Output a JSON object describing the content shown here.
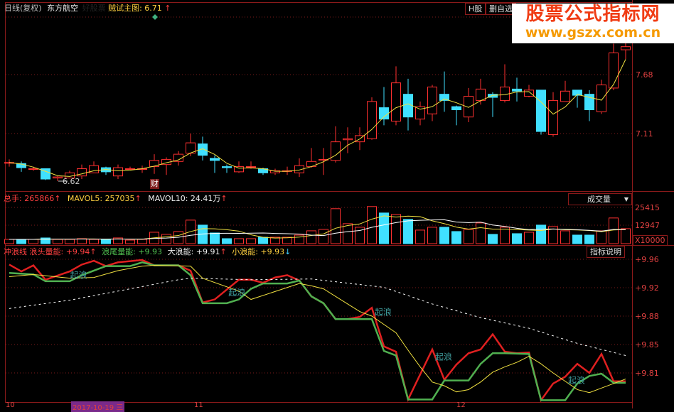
{
  "header": {
    "period": "日线(复权)",
    "stock_name": "东方航空",
    "hidden_label": "好股票",
    "indicator_name": "贼试主图",
    "indicator_value": "6.71",
    "arrow": "↑",
    "tab_h": "H股",
    "tab_watch": "删自选"
  },
  "logo": {
    "line1": "股票公式指标网",
    "line2": "www.gszx.com.cn"
  },
  "main": {
    "price_ticks": [
      "7.68",
      "7.11"
    ],
    "low_label": "6.62",
    "finance_badge": "财",
    "colors": {
      "up": "#ff3030",
      "down": "#40e0ff",
      "ma": "#f0e040"
    }
  },
  "volume": {
    "label_total": "总手",
    "total": "265866",
    "label_mavol5": "MAVOL5",
    "mavol5": "257035",
    "label_mavol10": "MAVOL10",
    "mavol10": "24.41万",
    "dropdown": "成交量",
    "ticks": [
      "25415",
      "12947"
    ],
    "unit": "X10000"
  },
  "indicator": {
    "name": "冲浪线",
    "l1_label": "浪头量能",
    "l1": "+9.94",
    "l2_label": "浪尾量能",
    "l2": "+9.93",
    "l3_label": "大浪能",
    "l3": "+9.91",
    "l4_label": "小浪能",
    "l4": "+9.93",
    "help_button": "指标说明",
    "ticks": [
      "+9.96",
      "+9.92",
      "+9.88",
      "+9.85",
      "+9.81"
    ],
    "wave_label": "起浪"
  },
  "time_axis": {
    "labels": [
      "10",
      "11",
      "12"
    ],
    "cursor_date": "2017-10-19 三"
  },
  "chart_data": {
    "type": "candlestick",
    "candles": [
      [
        6.83,
        6.83,
        6.86,
        6.79
      ],
      [
        6.82,
        6.78,
        6.84,
        6.74
      ],
      [
        6.77,
        6.77,
        6.79,
        6.75
      ],
      [
        6.77,
        6.67,
        6.77,
        6.66
      ],
      [
        6.68,
        6.69,
        6.7,
        6.65
      ],
      [
        6.68,
        6.73,
        6.75,
        6.68
      ],
      [
        6.7,
        6.77,
        6.81,
        6.67
      ],
      [
        6.73,
        6.8,
        6.84,
        6.73
      ],
      [
        6.78,
        6.74,
        6.79,
        6.71
      ],
      [
        6.7,
        6.78,
        6.81,
        6.67
      ],
      [
        6.77,
        6.77,
        6.79,
        6.76
      ],
      [
        6.77,
        6.77,
        6.8,
        6.73
      ],
      [
        6.79,
        6.85,
        6.91,
        6.72
      ],
      [
        6.81,
        6.86,
        6.88,
        6.71
      ],
      [
        6.84,
        6.91,
        6.94,
        6.8
      ],
      [
        6.92,
        7.02,
        7.11,
        6.89
      ],
      [
        7.01,
        6.9,
        7.08,
        6.85
      ],
      [
        6.87,
        6.85,
        6.9,
        6.73
      ],
      [
        6.79,
        6.78,
        6.81,
        6.73
      ],
      [
        6.74,
        6.79,
        6.84,
        6.73
      ],
      [
        6.79,
        6.79,
        6.84,
        6.77
      ],
      [
        6.77,
        6.73,
        6.78,
        6.71
      ],
      [
        6.73,
        6.75,
        6.77,
        6.71
      ],
      [
        6.75,
        6.75,
        6.79,
        6.71
      ],
      [
        6.73,
        6.8,
        6.87,
        6.69
      ],
      [
        6.79,
        6.84,
        6.97,
        6.78
      ],
      [
        6.86,
        6.86,
        6.97,
        6.71
      ],
      [
        6.85,
        7.03,
        7.18,
        6.83
      ],
      [
        7.05,
        7.06,
        7.17,
        6.92
      ],
      [
        7.03,
        7.09,
        7.17,
        6.95
      ],
      [
        7.06,
        7.42,
        7.46,
        7.05
      ],
      [
        7.36,
        7.25,
        7.56,
        7.19
      ],
      [
        7.23,
        7.6,
        7.76,
        7.19
      ],
      [
        7.49,
        7.27,
        7.64,
        7.14
      ],
      [
        7.25,
        7.37,
        7.42,
        7.19
      ],
      [
        7.3,
        7.56,
        7.58,
        7.23
      ],
      [
        7.49,
        7.43,
        7.71,
        7.32
      ],
      [
        7.37,
        7.34,
        7.38,
        7.19
      ],
      [
        7.27,
        7.47,
        7.55,
        7.22
      ],
      [
        7.43,
        7.54,
        7.64,
        7.39
      ],
      [
        7.49,
        7.46,
        7.51,
        7.27
      ],
      [
        7.43,
        7.56,
        7.78,
        7.41
      ],
      [
        7.54,
        7.52,
        7.65,
        7.42
      ],
      [
        7.47,
        7.53,
        7.58,
        7.46
      ],
      [
        7.53,
        7.13,
        7.53,
        7.1
      ],
      [
        7.1,
        7.43,
        7.51,
        7.08
      ],
      [
        7.42,
        7.52,
        7.62,
        7.42
      ],
      [
        7.53,
        7.48,
        7.53,
        7.36
      ],
      [
        7.49,
        7.34,
        7.53,
        7.23
      ],
      [
        7.32,
        7.58,
        7.63,
        7.3
      ],
      [
        7.55,
        7.89,
        7.98,
        7.53
      ],
      [
        7.92,
        7.95,
        7.99,
        7.83
      ]
    ],
    "volumes": [
      3000,
      3000,
      3000,
      4000,
      3000,
      3000,
      3500,
      3000,
      3000,
      4000,
      2500,
      3000,
      8000,
      6500,
      8500,
      16500,
      13000,
      7500,
      3500,
      3500,
      3500,
      4500,
      4500,
      4500,
      6000,
      9000,
      10000,
      24500,
      14000,
      11500,
      26000,
      21500,
      20500,
      17000,
      9500,
      11500,
      11500,
      8500,
      10000,
      14500,
      6500,
      11500,
      7000,
      8000,
      13000,
      12000,
      9000,
      6000,
      6000,
      9000,
      18000,
      10500
    ],
    "indicator_series": [
      {
        "name": "浪头量能",
        "color": "#e02020",
        "points": [
          [
            0,
            9.953
          ],
          [
            1,
            9.944
          ],
          [
            2,
            9.952
          ],
          [
            3,
            9.933
          ],
          [
            5,
            9.944
          ],
          [
            6,
            9.953
          ],
          [
            7,
            9.958
          ],
          [
            8,
            9.951
          ],
          [
            9,
            9.956
          ],
          [
            11,
            9.959
          ],
          [
            12,
            9.952
          ],
          [
            14,
            9.952
          ],
          [
            15,
            9.945
          ],
          [
            16,
            9.903
          ],
          [
            17,
            9.907
          ],
          [
            19,
            9.933
          ],
          [
            20,
            9.933
          ],
          [
            21,
            9.929
          ],
          [
            22,
            9.936
          ],
          [
            23,
            9.939
          ],
          [
            24,
            9.932
          ],
          [
            25,
            9.911
          ],
          [
            26,
            9.902
          ],
          [
            27,
            9.881
          ],
          [
            28,
            9.881
          ],
          [
            29,
            9.884
          ],
          [
            30,
            9.896
          ],
          [
            31,
            9.845
          ],
          [
            32,
            9.838
          ],
          [
            33,
            9.775
          ],
          [
            35,
            9.841
          ],
          [
            36,
            9.801
          ],
          [
            37,
            9.821
          ],
          [
            38,
            9.836
          ],
          [
            39,
            9.841
          ],
          [
            40,
            9.861
          ],
          [
            41,
            9.838
          ],
          [
            42,
            9.836
          ],
          [
            43,
            9.837
          ],
          [
            44,
            9.774
          ],
          [
            45,
            9.796
          ],
          [
            46,
            9.805
          ],
          [
            47,
            9.822
          ],
          [
            48,
            9.81
          ],
          [
            49,
            9.835
          ],
          [
            50,
            9.799
          ],
          [
            51,
            9.799
          ]
        ]
      },
      {
        "name": "浪尾量能",
        "color": "#50b050",
        "points": [
          [
            0,
            9.942
          ],
          [
            2,
            9.94
          ],
          [
            3,
            9.931
          ],
          [
            5,
            9.931
          ],
          [
            6,
            9.939
          ],
          [
            8,
            9.951
          ],
          [
            10,
            9.951
          ],
          [
            11,
            9.956
          ],
          [
            12,
            9.952
          ],
          [
            14,
            9.952
          ],
          [
            15,
            9.939
          ],
          [
            16,
            9.902
          ],
          [
            18,
            9.902
          ],
          [
            19,
            9.907
          ],
          [
            20,
            9.921
          ],
          [
            21,
            9.928
          ],
          [
            23,
            9.928
          ],
          [
            24,
            9.932
          ],
          [
            25,
            9.911
          ],
          [
            26,
            9.902
          ],
          [
            27,
            9.881
          ],
          [
            30,
            9.881
          ],
          [
            31,
            9.839
          ],
          [
            32,
            9.833
          ],
          [
            33,
            9.775
          ],
          [
            35,
            9.775
          ],
          [
            36,
            9.8
          ],
          [
            38,
            9.8
          ],
          [
            39,
            9.822
          ],
          [
            40,
            9.836
          ],
          [
            41,
            9.836
          ],
          [
            43,
            9.835
          ],
          [
            44,
            9.774
          ],
          [
            46,
            9.774
          ],
          [
            47,
            9.796
          ],
          [
            48,
            9.806
          ],
          [
            49,
            9.809
          ],
          [
            50,
            9.797
          ],
          [
            51,
            9.797
          ]
        ]
      },
      {
        "name": "大浪能",
        "color": "#ffffff",
        "dashed": true,
        "points": [
          [
            0,
            9.895
          ],
          [
            5,
            9.906
          ],
          [
            9,
            9.918
          ],
          [
            14,
            9.933
          ],
          [
            15,
            9.935
          ],
          [
            20,
            9.933
          ],
          [
            25,
            9.934
          ],
          [
            31,
            9.923
          ],
          [
            35,
            9.901
          ],
          [
            39,
            9.883
          ],
          [
            43,
            9.869
          ],
          [
            47,
            9.849
          ],
          [
            51,
            9.833
          ]
        ]
      },
      {
        "name": "小浪能",
        "color": "#f0e040",
        "points": [
          [
            0,
            9.937
          ],
          [
            2,
            9.94
          ],
          [
            5,
            9.935
          ],
          [
            7,
            9.936
          ],
          [
            9,
            9.945
          ],
          [
            11,
            9.951
          ],
          [
            12,
            9.952
          ],
          [
            15,
            9.951
          ],
          [
            16,
            9.935
          ],
          [
            19,
            9.918
          ],
          [
            20,
            9.907
          ],
          [
            24,
            9.928
          ],
          [
            25,
            9.925
          ],
          [
            26,
            9.921
          ],
          [
            28,
            9.901
          ],
          [
            29,
            9.891
          ],
          [
            30,
            9.885
          ],
          [
            31,
            9.874
          ],
          [
            32,
            9.863
          ],
          [
            33,
            9.84
          ],
          [
            34,
            9.818
          ],
          [
            35,
            9.798
          ],
          [
            36,
            9.793
          ],
          [
            37,
            9.785
          ],
          [
            38,
            9.788
          ],
          [
            39,
            9.798
          ],
          [
            40,
            9.811
          ],
          [
            41,
            9.818
          ],
          [
            42,
            9.824
          ],
          [
            43,
            9.832
          ],
          [
            44,
            9.822
          ],
          [
            45,
            9.81
          ],
          [
            46,
            9.799
          ],
          [
            47,
            9.788
          ],
          [
            48,
            9.784
          ],
          [
            49,
            9.79
          ],
          [
            50,
            9.796
          ],
          [
            51,
            9.802
          ]
        ]
      }
    ],
    "wave_marks": [
      [
        5.5,
        9.94
      ],
      [
        18.6,
        9.917
      ],
      [
        30.7,
        9.891
      ],
      [
        35.7,
        9.832
      ],
      [
        46.7,
        9.801
      ]
    ]
  }
}
